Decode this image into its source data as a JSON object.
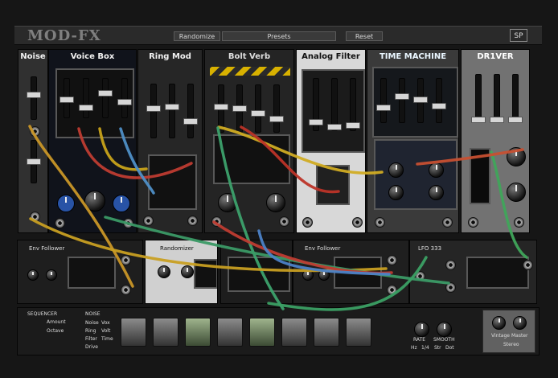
{
  "header": {
    "logo": "MOD-FX",
    "randomize": "Randomize",
    "presets": "Presets",
    "reset": "Reset",
    "brand": "SP"
  },
  "modules": {
    "noise": {
      "title": "Noise"
    },
    "voice_box": {
      "title": "Voice Box"
    },
    "ring_mod": {
      "title": "Ring Mod"
    },
    "bolt_verb": {
      "title": "Bolt Verb"
    },
    "analog_filter": {
      "title": "Analog Filter"
    },
    "time_machine": {
      "title": "TIME MACHINE"
    },
    "drive": {
      "title": "DR1VER"
    }
  },
  "lower": {
    "env1": {
      "title": "Env Follower"
    },
    "randomizer": {
      "title": "Randomizer"
    },
    "env2": {
      "title": "Env Follower"
    },
    "lfo": {
      "title": "LFO 333"
    },
    "sequencer": {
      "title": "SEQUENCER",
      "item1": "Amount",
      "item2": "Octave"
    },
    "noise2": {
      "title": "NOISE",
      "a": "Noise",
      "b": "Vox",
      "c": "Ring",
      "d": "Volt",
      "e": "Filter",
      "f": "Time",
      "g": "Drive"
    },
    "rate_smooth": {
      "rate": "RATE",
      "smooth": "SMOOTH",
      "opt1": "Hz",
      "opt2": "1/4",
      "opt3": "Str",
      "opt4": "Dot"
    },
    "output": {
      "vintage": "Vintage",
      "master": "Master",
      "mode": "Stereo"
    }
  }
}
